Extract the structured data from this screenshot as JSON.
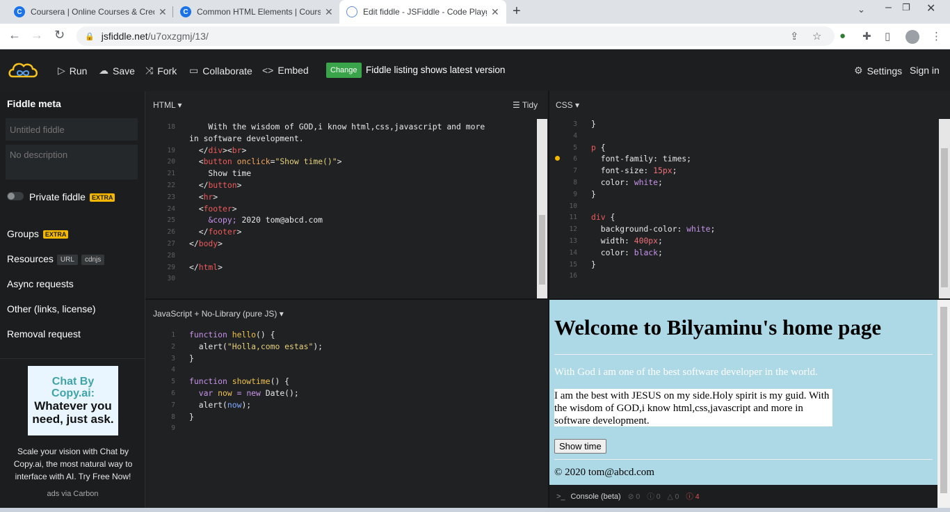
{
  "browser": {
    "tabs": [
      {
        "title": "Coursera | Online Courses & Cred",
        "active": false
      },
      {
        "title": "Common HTML Elements | Cours",
        "active": false
      },
      {
        "title": "Edit fiddle - JSFiddle - Code Playg",
        "active": true
      }
    ],
    "url_host": "jsfiddle.net",
    "url_path": "/u7oxzgmj/13/"
  },
  "header": {
    "run": "Run",
    "save": "Save",
    "fork": "Fork",
    "collaborate": "Collaborate",
    "embed": "Embed",
    "change": "Change",
    "listing": "Fiddle listing shows latest version",
    "settings": "Settings",
    "signin": "Sign in"
  },
  "sidebar": {
    "title": "Fiddle meta",
    "title_placeholder": "Untitled fiddle",
    "desc_placeholder": "No description",
    "private": "Private fiddle",
    "extra": "EXTRA",
    "groups": "Groups",
    "resources": "Resources",
    "url_pill": "URL",
    "cdnjs_pill": "cdnjs",
    "async": "Async requests",
    "other": "Other (links, license)",
    "removal": "Removal request",
    "ad_line1": "Chat By",
    "ad_line2": "Copy.ai:",
    "ad_line3": "Whatever you need, just ask.",
    "ad_text": "Scale your vision with Chat by Copy.ai, the most natural way to interface with AI. Try Free Now!",
    "ad_via": "ads via Carbon"
  },
  "panels": {
    "html": "HTML ▾",
    "tidy": "Tidy",
    "css": "CSS ▾",
    "js": "JavaScript + No-Library (pure JS) ▾"
  },
  "html_lines": [
    "18",
    "19",
    "20",
    "21",
    "22",
    "23",
    "24",
    "25",
    "26",
    "27",
    "28",
    "29",
    "30"
  ],
  "css_lines": [
    "3",
    "4",
    "5",
    "6",
    "7",
    "8",
    "9",
    "10",
    "11",
    "12",
    "13",
    "14",
    "15",
    "16"
  ],
  "js_lines": [
    "1",
    "2",
    "3",
    "4",
    "5",
    "6",
    "7",
    "8",
    "9"
  ],
  "result": {
    "heading": "Welcome to Bilyaminu's home page",
    "p1": "With God i am one of the best software developer in the world.",
    "box": "I am the best with JESUS on my side.Holy spirit is my guid. With the wisdom of GOD,i know html,css,javascript and more in software development.",
    "button": "Show time",
    "footer": "© 2020 tom@abcd.com"
  },
  "console": {
    "label": "Console (beta)",
    "c1": "0",
    "c2": "0",
    "c3": "0",
    "errors": "4"
  }
}
